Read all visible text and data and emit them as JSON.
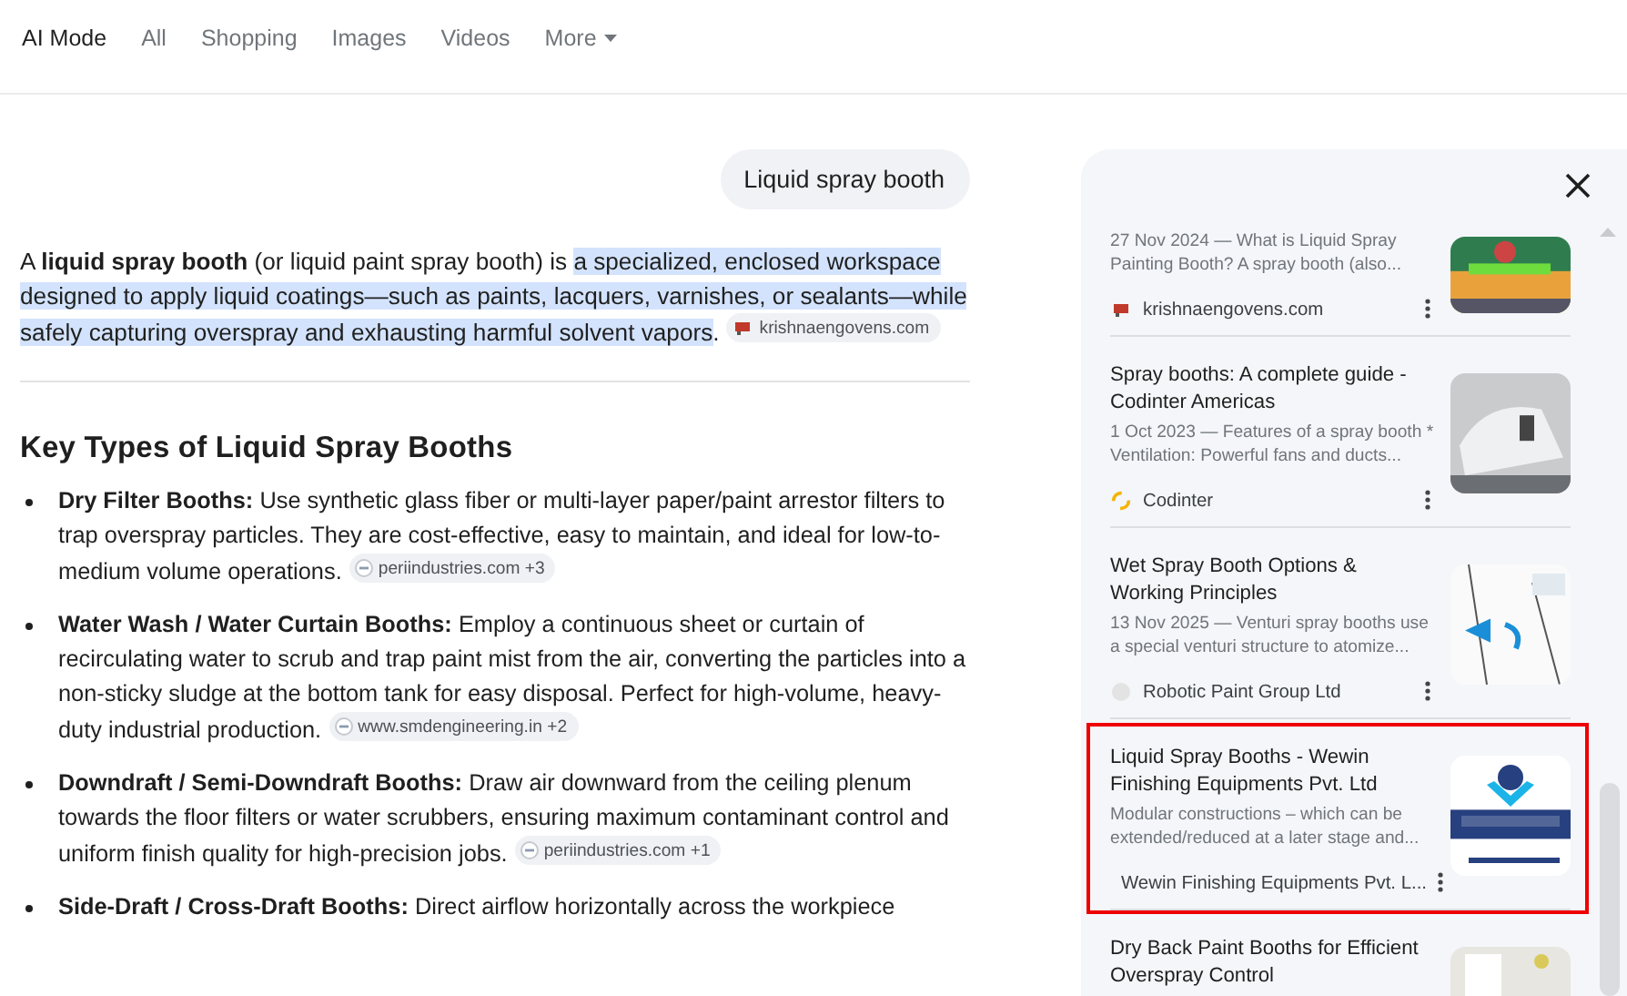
{
  "nav": {
    "tabs": [
      {
        "label": "AI Mode",
        "selected": true,
        "kind": "tab"
      },
      {
        "label": "All",
        "selected": false,
        "kind": "tab"
      },
      {
        "label": "Shopping",
        "selected": false,
        "kind": "tab"
      },
      {
        "label": "Images",
        "selected": false,
        "kind": "tab"
      },
      {
        "label": "Videos",
        "selected": false,
        "kind": "tab"
      },
      {
        "label": "More",
        "selected": false,
        "kind": "menu"
      }
    ]
  },
  "query": "Liquid spray booth",
  "answer": {
    "intro": {
      "lead": "A **liquid spray booth** (or liquid paint spray booth) is",
      "highlight": "a specialized, enclosed workspace designed to apply liquid coatings—such as paints, lacquers, varnishes, or sealants—while safely capturing overspray and exhausting harmful solvent vapors",
      "end": ".",
      "source": "krishnaengovens.com"
    },
    "heading": "Key Types of Liquid Spray Booths",
    "items": [
      {
        "term": "Dry Filter Booths:",
        "text": "Use synthetic glass fiber or multi-layer paper/paint arrestor filters to trap overspray particles. They are cost-effective, easy to maintain, and ideal for low-to-medium volume operations.",
        "source": "periindustries.com",
        "extra": "+3"
      },
      {
        "term": "Water Wash / Water Curtain Booths:",
        "text": "Employ a continuous sheet or curtain of recirculating water to scrub and trap paint mist from the air, converting the particles into a non-sticky sludge at the bottom tank for easy disposal. Perfect for high-volume, heavy-duty industrial production.",
        "source": "www.smdengineering.in",
        "extra": "+2"
      },
      {
        "term": "Downdraft / Semi-Downdraft Booths:",
        "text": "Draw air downward from the ceiling plenum towards the floor filters or water scrubbers, ensuring maximum contaminant control and uniform finish quality for high-precision jobs.",
        "source": "periindustries.com",
        "extra": "+1"
      },
      {
        "term": "Side-Draft / Cross-Draft Booths:",
        "text": "Direct airflow horizontally across the workpiece"
      }
    ]
  },
  "sources_panel": {
    "cards": [
      {
        "snippet": "27 Nov 2024 — What is Liquid Spray Painting Booth? A spray booth (also...",
        "source": "krishnaengovens.com",
        "selected": false
      },
      {
        "title": "Spray booths: A complete guide - Codinter Americas",
        "snippet": "1 Oct 2023 — Features of a spray booth * Ventilation: Powerful fans and ducts...",
        "source": "Codinter",
        "selected": false
      },
      {
        "title": "Wet Spray Booth Options & Working Principles",
        "snippet": "13 Nov 2025 — Venturi spray booths use a special venturi structure to atomize...",
        "source": "Robotic Paint Group Ltd",
        "selected": false
      },
      {
        "title": "Liquid Spray Booths - Wewin Finishing Equipments Pvt. Ltd",
        "snippet": "Modular constructions – which can be extended/reduced at a later stage and...",
        "source": "Wewin Finishing Equipments Pvt. L...",
        "selected": true
      },
      {
        "title": "Dry Back Paint Booths for Efficient Overspray Control",
        "selected": false
      }
    ]
  }
}
